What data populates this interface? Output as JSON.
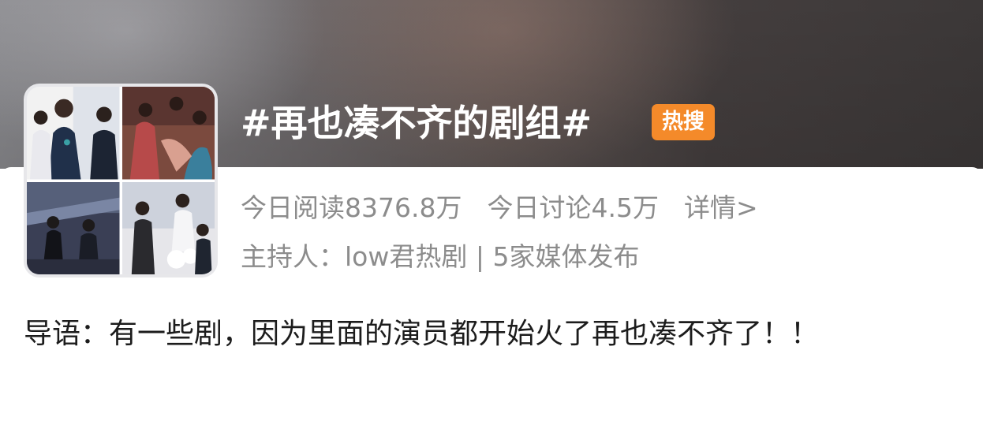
{
  "topic": {
    "title": "#再也凑不齐的剧组#",
    "badge": "热搜"
  },
  "stats": {
    "reads": "今日阅读8376.8万",
    "discussions": "今日讨论4.5万",
    "details_link": "详情>"
  },
  "host": {
    "line": "主持人：low君热剧 | 5家媒体发布"
  },
  "intro": {
    "text": "导语：有一些剧，因为里面的演员都开始火了再也凑不齐了！！"
  },
  "colors": {
    "badge_bg": "#f48a2a",
    "meta_text": "#8c8c8c",
    "body_text": "#1c1c1c"
  }
}
